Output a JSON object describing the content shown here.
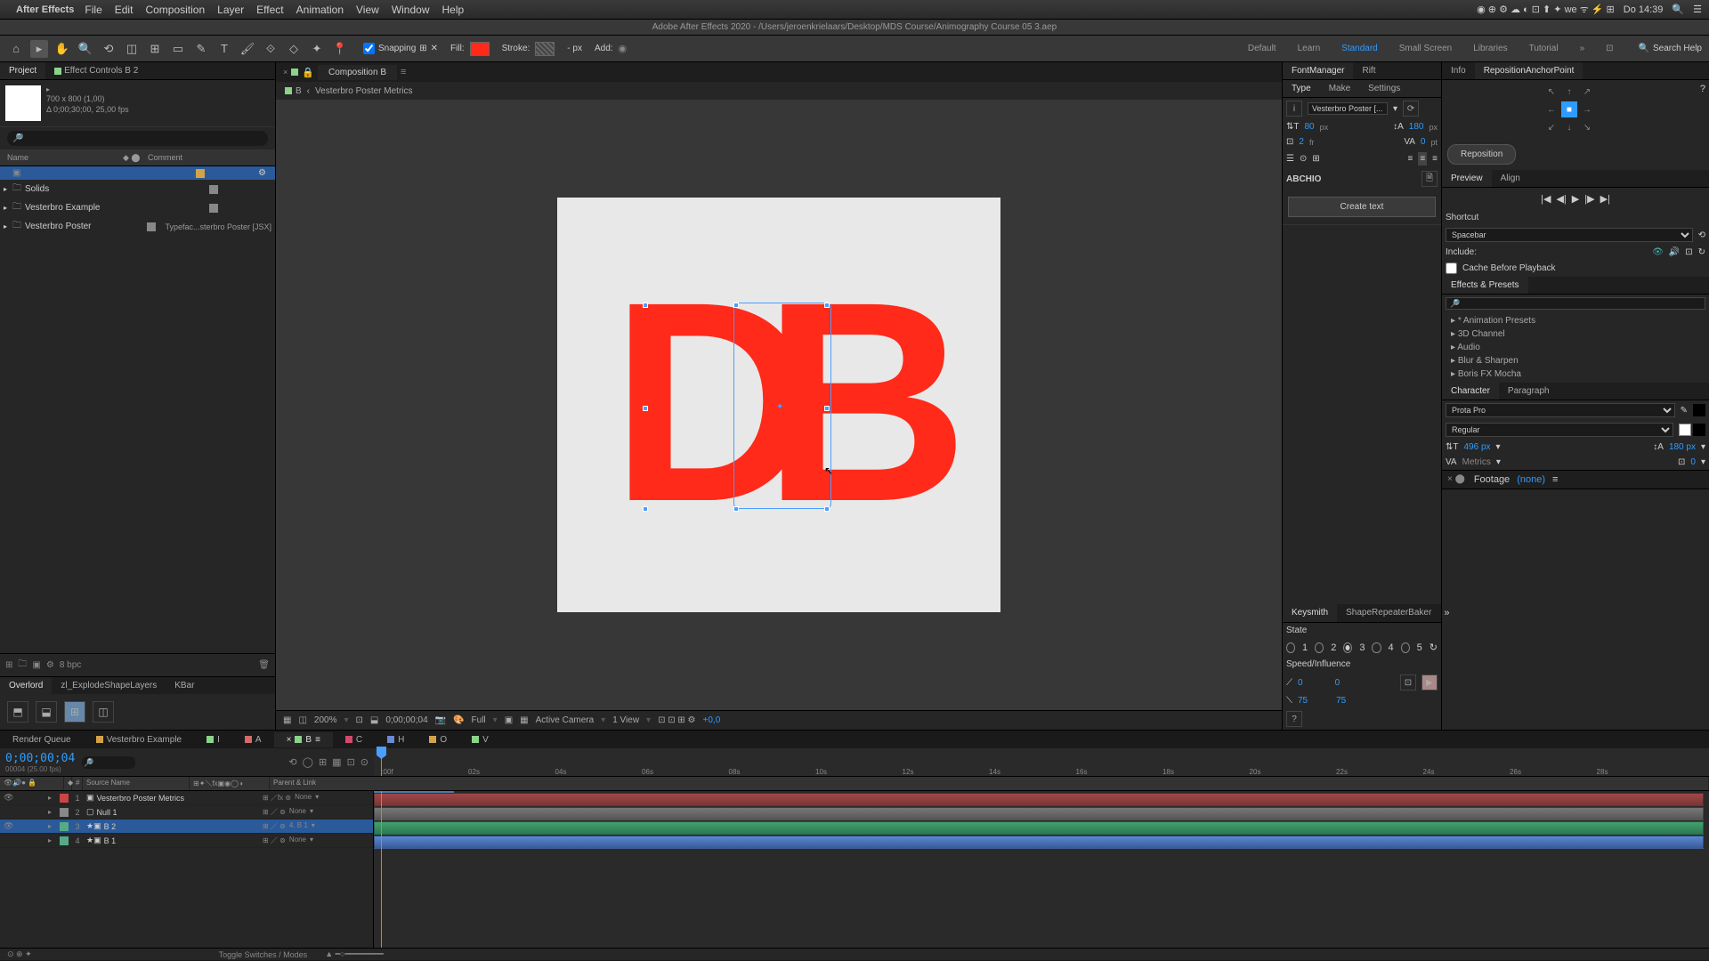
{
  "mac": {
    "app": "After Effects",
    "menus": [
      "File",
      "Edit",
      "Composition",
      "Layer",
      "Effect",
      "Animation",
      "View",
      "Window",
      "Help"
    ],
    "clock": "Do 14:39"
  },
  "title": "Adobe After Effects 2020 - /Users/jeroenkrielaars/Desktop/MDS Course/Animography Course 05 3.aep",
  "tools": {
    "snapping": "Snapping",
    "fill": "Fill:",
    "stroke": "Stroke:",
    "strokepx": "- px",
    "add": "Add:"
  },
  "workspaces": [
    "Default",
    "Learn",
    "Standard",
    "Small Screen",
    "Libraries",
    "Tutorial"
  ],
  "search_help": "Search Help",
  "project": {
    "tabs": [
      "Project",
      "Effect Controls B 2"
    ],
    "meta": {
      "dim": "700 x 800 (1,00)",
      "dur": "Δ 0;00;30;00, 25,00 fps"
    },
    "cols": {
      "name": "Name",
      "comment": "Comment"
    },
    "rows": [
      {
        "name": "",
        "color": "#d4a348",
        "selected": true
      },
      {
        "name": "Solids",
        "folder": true,
        "color": "#888"
      },
      {
        "name": "Vesterbro Example",
        "folder": true,
        "color": "#888"
      },
      {
        "name": "Vesterbro Poster",
        "folder": true,
        "color": "#888",
        "comment": "Typefac...sterbro Poster [JSX]"
      }
    ],
    "bpc": "8 bpc"
  },
  "subtabs": [
    "Overlord",
    "zl_ExplodeShapeLayers",
    "KBar"
  ],
  "comp": {
    "tab": "Composition B",
    "crumb_b": "B",
    "crumb_metrics": "Vesterbro Poster Metrics"
  },
  "letters": "DB",
  "viewer_footer": {
    "zoom": "200%",
    "time": "0;00;00;04",
    "res": "Full",
    "camera": "Active Camera",
    "views": "1 View",
    "exp": "+0,0"
  },
  "fm": {
    "tabs": [
      "FontManager",
      "Rift"
    ],
    "subs": [
      "Type",
      "Make",
      "Settings"
    ],
    "font": "Vesterbro Poster [...",
    "size": "80",
    "size_u": "px",
    "lh": "180",
    "lh_u": "px",
    "tr": "2",
    "tr_u": "fr",
    "kn": "0",
    "kn_u": "pt",
    "abc": "ABCHIO",
    "create": "Create text"
  },
  "ks": {
    "tabs": [
      "Keysmith",
      "ShapeRepeaterBaker"
    ],
    "state": "State",
    "labels": [
      "1",
      "2",
      "3",
      "4",
      "5"
    ],
    "speed": "Speed/Influence",
    "v1": "0",
    "v2": "0",
    "v3": "75",
    "v4": "75"
  },
  "info": {
    "tabs": [
      "Info",
      "RepositionAnchorPoint"
    ],
    "reposition": "Reposition"
  },
  "preview": {
    "tabs": [
      "Preview",
      "Align"
    ],
    "shortcut_lbl": "Shortcut",
    "shortcut": "Spacebar",
    "include": "Include:",
    "cache": "Cache Before Playback"
  },
  "fx": {
    "title": "Effects & Presets",
    "items": [
      "* Animation Presets",
      "3D Channel",
      "Audio",
      "Blur & Sharpen",
      "Boris FX Mocha"
    ]
  },
  "char": {
    "tabs": [
      "Character",
      "Paragraph"
    ],
    "font": "Prota Pro",
    "style": "Regular",
    "size": "496 px",
    "lh": "180 px",
    "tr": "Metrics",
    "kn": "0"
  },
  "footage": {
    "label": "Footage",
    "none": "(none)"
  },
  "timeline": {
    "tabs": [
      {
        "label": "Render Queue"
      },
      {
        "label": "Vesterbro Example",
        "color": "#d4a348"
      },
      {
        "label": "I",
        "color": "#8ad48a"
      },
      {
        "label": "A",
        "color": "#d46a6a"
      },
      {
        "label": "B",
        "color": "#8ad48a",
        "active": true,
        "close": true
      },
      {
        "label": "C",
        "color": "#d4486a"
      },
      {
        "label": "H",
        "color": "#6a8ad4"
      },
      {
        "label": "O",
        "color": "#d4a348"
      },
      {
        "label": "V",
        "color": "#8ad48a"
      }
    ],
    "timecode": "0;00;00;04",
    "subtime": "00004 (25.00 fps)",
    "cols": {
      "source": "Source Name",
      "parent": "Parent & Link"
    },
    "ticks": [
      ":00f",
      "02s",
      "04s",
      "06s",
      "08s",
      "10s",
      "12s",
      "14s",
      "16s",
      "18s",
      "20s",
      "22s",
      "24s",
      "26s",
      "28s"
    ],
    "layers": [
      {
        "n": "1",
        "color": "#c44",
        "name": "Vesterbro Poster Metrics",
        "parent": "None"
      },
      {
        "n": "2",
        "color": "#888",
        "name": "Null 1",
        "parent": "None"
      },
      {
        "n": "3",
        "color": "#5a8",
        "name": "B 2",
        "parent": "4. B 1",
        "selected": true
      },
      {
        "n": "4",
        "color": "#5a8",
        "name": "B 1",
        "parent": "None"
      }
    ]
  },
  "footer": {
    "tsm": "Toggle Switches / Modes"
  }
}
